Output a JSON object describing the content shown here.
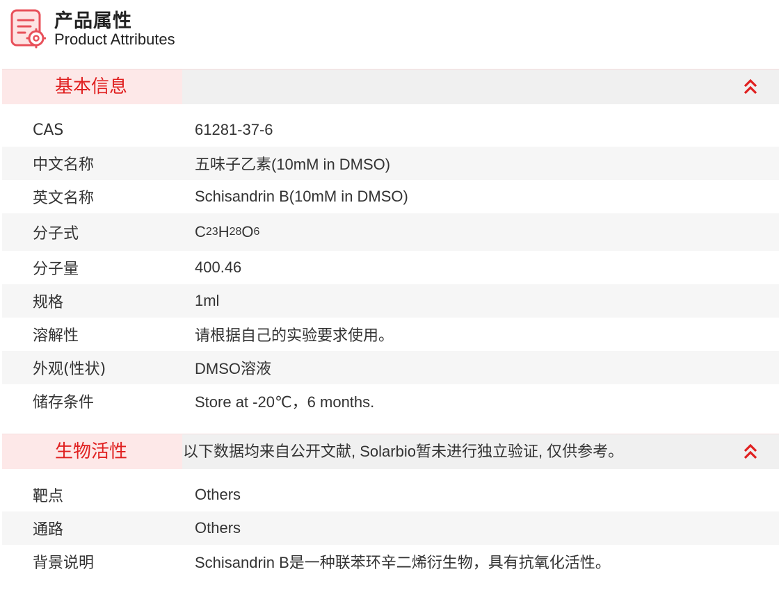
{
  "header": {
    "title_cn": "产品属性",
    "title_en": "Product Attributes",
    "icon": "document-gear-icon"
  },
  "colors": {
    "accent": "#e02020",
    "section_label_bg": "#fde8e8",
    "section_bar_bg": "#f0f0f0",
    "alt_row_bg": "#f6f6f6"
  },
  "basic": {
    "label": "基本信息",
    "collapse_icon": "double-chevron-up-icon",
    "rows": [
      {
        "key": "CAS",
        "value": "61281-37-6"
      },
      {
        "key": "中文名称",
        "value": "五味子乙素(10mM in DMSO)"
      },
      {
        "key": "英文名称",
        "value": "Schisandrin B(10mM in DMSO)"
      },
      {
        "key": "分子式",
        "value": "C23H28O6",
        "formula": {
          "c": "C",
          "c_n": "23",
          "h": "H",
          "h_n": "28",
          "o": "O",
          "o_n": "6"
        }
      },
      {
        "key": "分子量",
        "value": "400.46"
      },
      {
        "key": "规格",
        "value": "1ml"
      },
      {
        "key": "溶解性",
        "value": "请根据自己的实验要求使用。"
      },
      {
        "key": "外观(性状)",
        "value": "DMSO溶液"
      },
      {
        "key": "储存条件",
        "value": "Store at -20℃，6 months."
      }
    ]
  },
  "bio": {
    "label": "生物活性",
    "note": "以下数据均来自公开文献, Solarbio暂未进行独立验证, 仅供参考。",
    "collapse_icon": "double-chevron-up-icon",
    "rows": [
      {
        "key": "靶点",
        "value": "Others"
      },
      {
        "key": "通路",
        "value": "Others"
      },
      {
        "key": "背景说明",
        "value": "Schisandrin B是一种联苯环辛二烯衍生物，具有抗氧化活性。"
      }
    ]
  }
}
